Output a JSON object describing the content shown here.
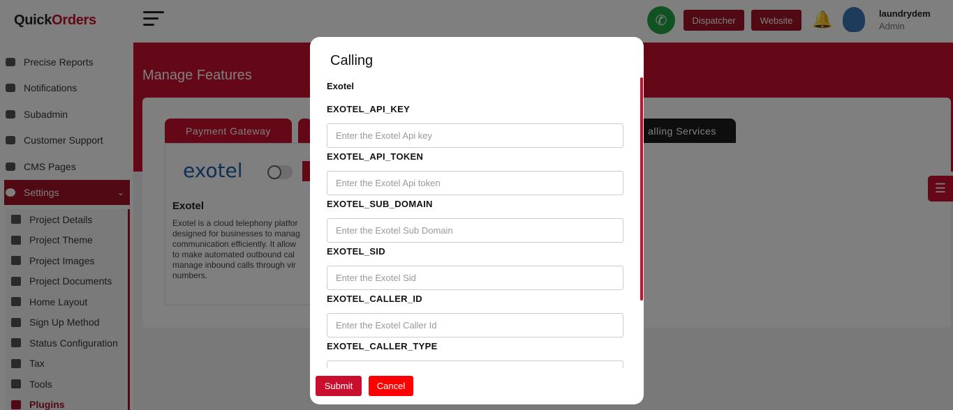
{
  "app": {
    "logo_prefix": "Quick",
    "logo_accent": "Orders"
  },
  "sidebar": {
    "items": [
      {
        "label": "Precise Reports",
        "icon": "reports-icon"
      },
      {
        "label": "Notifications",
        "icon": "bell-icon"
      },
      {
        "label": "Subadmin",
        "icon": "users-icon"
      },
      {
        "label": "Customer Support",
        "icon": "support-icon"
      },
      {
        "label": "CMS Pages",
        "icon": "pages-icon"
      }
    ],
    "settings": {
      "label": "Settings",
      "icon": "gear-icon"
    },
    "submenu": [
      {
        "label": "Project Details",
        "icon": "details-icon"
      },
      {
        "label": "Project Theme",
        "icon": "palette-icon"
      },
      {
        "label": "Project Images",
        "icon": "image-icon"
      },
      {
        "label": "Project Documents",
        "icon": "document-icon"
      },
      {
        "label": "Home Layout",
        "icon": "home-icon"
      },
      {
        "label": "Sign Up Method",
        "icon": "signup-icon"
      },
      {
        "label": "Status Configuration",
        "icon": "status-icon"
      },
      {
        "label": "Tax",
        "icon": "tax-icon"
      },
      {
        "label": "Tools",
        "icon": "tools-icon"
      },
      {
        "label": "Plugins",
        "icon": "plugin-icon"
      }
    ]
  },
  "header": {
    "dispatcher_label": "Dispatcher",
    "website_label": "Website",
    "user_name": "laundrydem",
    "user_role": "Admin"
  },
  "main": {
    "page_title": "Manage Features",
    "tabs": [
      {
        "label": "Payment Gateway"
      },
      {
        "label": "alling Services"
      }
    ],
    "service": {
      "logo_text": "exotel",
      "title": "Exotel",
      "description": "Exotel is a cloud telephony platfor\ndesigned for businesses to manag\ncommunication efficiently. It allow\nto make automated outbound cal\nmanage inbound calls through vir\nnumbers."
    }
  },
  "modal": {
    "title": "Calling",
    "section": "Exotel",
    "fields": [
      {
        "label": "EXOTEL_API_KEY",
        "placeholder": "Enter the Exotel Api key",
        "value": ""
      },
      {
        "label": "EXOTEL_API_TOKEN",
        "placeholder": "Enter the Exotel Api token",
        "value": ""
      },
      {
        "label": "EXOTEL_SUB_DOMAIN",
        "placeholder": "Enter the Exotel Sub Domain",
        "value": ""
      },
      {
        "label": "EXOTEL_SID",
        "placeholder": "Enter the Exotel Sid",
        "value": ""
      },
      {
        "label": "EXOTEL_CALLER_ID",
        "placeholder": "Enter the Exotel Caller Id",
        "value": ""
      },
      {
        "label": "EXOTEL_CALLER_TYPE",
        "placeholder": "",
        "value": ""
      }
    ],
    "submit_label": "Submit",
    "cancel_label": "Cancel"
  },
  "colors": {
    "brand": "#c8102e",
    "dark_tab": "#1c1c1c",
    "whatsapp": "#25a244",
    "cancel": "#ff0000"
  }
}
